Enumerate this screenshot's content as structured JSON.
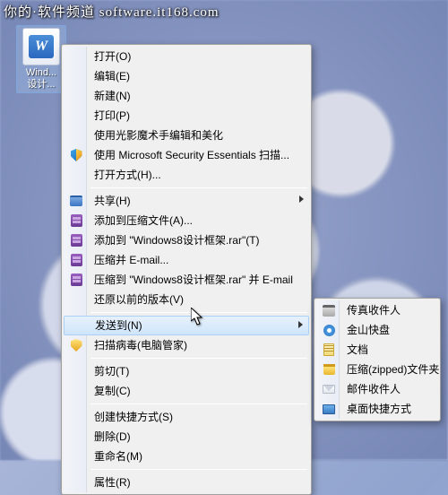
{
  "overlay": "你的·软件频道 software.it168.com",
  "desktop": {
    "file_label_line1": "Wind...",
    "file_label_line2": "设计..."
  },
  "main_menu": {
    "open": "打开(O)",
    "edit": "编辑(E)",
    "new": "新建(N)",
    "print": "打印(P)",
    "guangying": "使用光影魔术手编辑和美化",
    "mse": "使用 Microsoft Security Essentials 扫描...",
    "open_with": "打开方式(H)...",
    "share": "共享(H)",
    "add_archive": "添加到压缩文件(A)...",
    "add_to_named": "添加到 \"Windows8设计框架.rar\"(T)",
    "compress_email": "压缩并 E-mail...",
    "compress_named_email": "压缩到 \"Windows8设计框架.rar\" 并 E-mail",
    "restore_prev": "还原以前的版本(V)",
    "send_to": "发送到(N)",
    "scan_virus": "扫描病毒(电脑管家)",
    "cut": "剪切(T)",
    "copy": "复制(C)",
    "create_shortcut": "创建快捷方式(S)",
    "delete": "删除(D)",
    "rename": "重命名(M)",
    "properties": "属性(R)"
  },
  "sub_menu": {
    "fax": "传真收件人",
    "kuaipan": "金山快盘",
    "documents": "文档",
    "zipped": "压缩(zipped)文件夹",
    "mail": "邮件收件人",
    "desktop_shortcut": "桌面快捷方式"
  }
}
